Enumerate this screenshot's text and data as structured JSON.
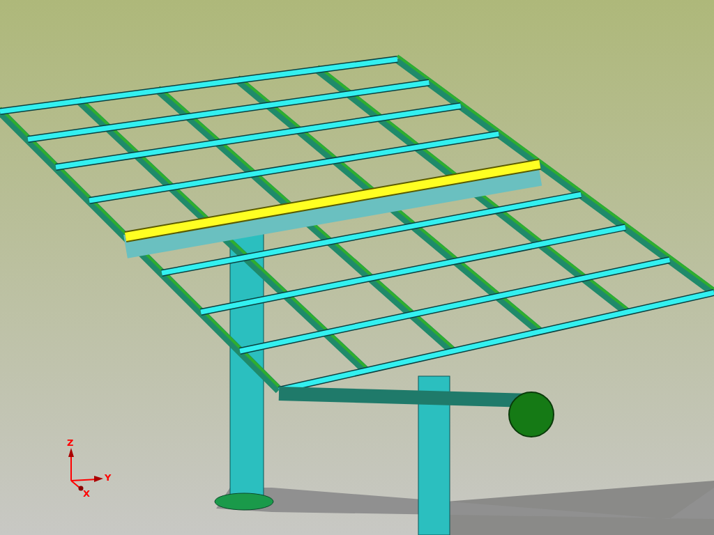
{
  "axis_triad": {
    "z_label": "Z",
    "y_label": "Y",
    "x_label": "X"
  }
}
